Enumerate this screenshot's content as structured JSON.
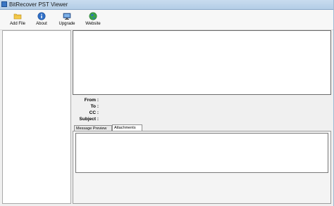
{
  "window": {
    "title": "BitRecover PST Viewer"
  },
  "toolbar": {
    "buttons": [
      {
        "label": "Add File",
        "icon": "folder-icon"
      },
      {
        "label": "About",
        "icon": "info-icon"
      },
      {
        "label": "Upgrade",
        "icon": "monitor-icon"
      },
      {
        "label": "Website",
        "icon": "globe-icon"
      }
    ]
  },
  "mail_header": {
    "from_label": "From :",
    "to_label": "To :",
    "cc_label": "CC :",
    "subject_label": "Subject :"
  },
  "tabs": [
    {
      "label": "Message Preview",
      "active": false
    },
    {
      "label": "Attachments",
      "active": true
    }
  ]
}
